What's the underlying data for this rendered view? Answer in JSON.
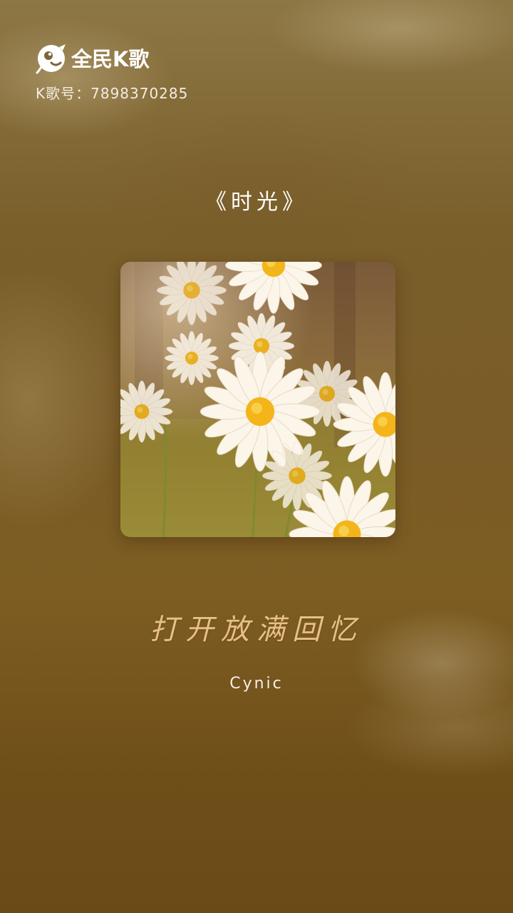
{
  "brand": {
    "app_name": "全民K歌",
    "logo_icon": "karaoke-bird-logo-icon"
  },
  "account": {
    "k_number_label": "K歌号：7898370285"
  },
  "song": {
    "title": "《时光》",
    "cover_image": "daisy-flowers-photo",
    "lyric_line": "打开放满回忆",
    "artist": "Cynic"
  },
  "colors": {
    "background": "#7a5c27",
    "lyric_text": "#e7c088",
    "primary_text": "#ffffff"
  }
}
